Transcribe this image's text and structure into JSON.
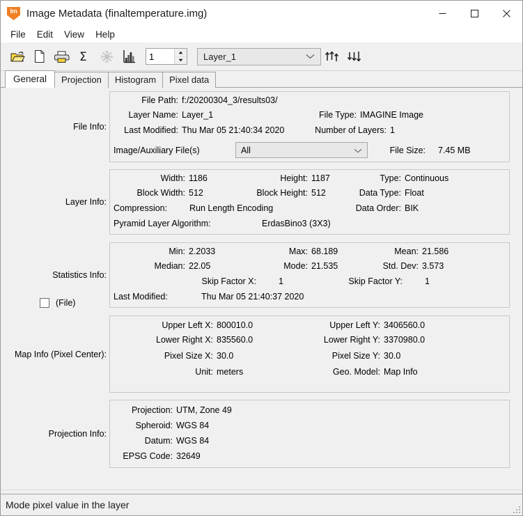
{
  "window": {
    "title": "Image Metadata (finaltemperature.img)",
    "app_icon_text": "Im",
    "minimize_label": "Minimize",
    "maximize_label": "Maximize",
    "close_label": "Close"
  },
  "menubar": {
    "items": [
      {
        "label": "File"
      },
      {
        "label": "Edit"
      },
      {
        "label": "View"
      },
      {
        "label": "Help"
      }
    ]
  },
  "toolbar": {
    "icons": [
      {
        "name": "open-folder-icon",
        "title": "Open"
      },
      {
        "name": "new-file-icon",
        "title": "New"
      },
      {
        "name": "print-icon",
        "title": "Print"
      },
      {
        "name": "sigma-statistics-icon",
        "title": "Statistics"
      },
      {
        "name": "snowflake-icon",
        "title": "Compute"
      },
      {
        "name": "histogram-chart-icon",
        "title": "Histogram"
      }
    ],
    "layer_number": "1",
    "layer_select_value": "Layer_1",
    "layer_select_options": [
      "Layer_1"
    ],
    "up-arrows-title": "Previous layer",
    "down-arrows-title": "Next layer"
  },
  "tabs": [
    {
      "label": "General",
      "active": true
    },
    {
      "label": "Projection",
      "active": false
    },
    {
      "label": "Histogram",
      "active": false
    },
    {
      "label": "Pixel data",
      "active": false
    }
  ],
  "sections": {
    "file_info": {
      "label": "File Info:",
      "file_path_label": "File Path:",
      "file_path_value": "f:/20200304_3/results03/",
      "layer_name_label": "Layer Name:",
      "layer_name_value": "Layer_1",
      "file_type_label": "File Type:",
      "file_type_value": "IMAGINE Image",
      "last_modified_label": "Last Modified:",
      "last_modified_value": "Thu Mar 05 21:40:34 2020",
      "number_of_layers_label": "Number of Layers:",
      "number_of_layers_value": "1",
      "aux_files_label": "Image/Auxiliary File(s)",
      "aux_files_value": "All",
      "aux_files_options": [
        "All"
      ],
      "file_size_label": "File Size:",
      "file_size_value": "7.45 MB"
    },
    "layer_info": {
      "label": "Layer Info:",
      "width_label": "Width:",
      "width_value": "1186",
      "height_label": "Height:",
      "height_value": "1187",
      "type_label": "Type:",
      "type_value": "Continuous",
      "block_width_label": "Block Width:",
      "block_width_value": "512",
      "block_height_label": "Block Height:",
      "block_height_value": "512",
      "data_type_label": "Data Type:",
      "data_type_value": "Float",
      "compression_label": "Compression:",
      "compression_value": "Run Length Encoding",
      "data_order_label": "Data Order:",
      "data_order_value": "BIK",
      "pyramid_label": "Pyramid Layer Algorithm:",
      "pyramid_value": "ErdasBino3 (3X3)"
    },
    "statistics_info": {
      "label": "Statistics Info:",
      "file_checkbox_label": "(File)",
      "file_checkbox_checked": false,
      "min_label": "Min:",
      "min_value": "2.2033",
      "max_label": "Max:",
      "max_value": "68.189",
      "mean_label": "Mean:",
      "mean_value": "21.586",
      "median_label": "Median:",
      "median_value": "22.05",
      "mode_label": "Mode:",
      "mode_value": "21.535",
      "stddev_label": "Std. Dev:",
      "stddev_value": "3.573",
      "skip_x_label": "Skip Factor X:",
      "skip_x_value": "1",
      "skip_y_label": "Skip Factor Y:",
      "skip_y_value": "1",
      "last_modified_label": "Last Modified:",
      "last_modified_value": "Thu Mar 05 21:40:37 2020"
    },
    "map_info": {
      "label": "Map Info (Pixel Center):",
      "upper_left_x_label": "Upper Left X:",
      "upper_left_x_value": "800010.0",
      "upper_left_y_label": "Upper Left Y:",
      "upper_left_y_value": "3406560.0",
      "lower_right_x_label": "Lower Right X:",
      "lower_right_x_value": "835560.0",
      "lower_right_y_label": "Lower Right Y:",
      "lower_right_y_value": "3370980.0",
      "pixel_size_x_label": "Pixel Size X:",
      "pixel_size_x_value": "30.0",
      "pixel_size_y_label": "Pixel Size Y:",
      "pixel_size_y_value": "30.0",
      "unit_label": "Unit:",
      "unit_value": "meters",
      "geo_model_label": "Geo. Model:",
      "geo_model_value": "Map Info"
    },
    "projection_info": {
      "label": "Projection Info:",
      "projection_label": "Projection:",
      "projection_value": "UTM, Zone 49",
      "spheroid_label": "Spheroid:",
      "spheroid_value": "WGS 84",
      "datum_label": "Datum:",
      "datum_value": "WGS 84",
      "epsg_label": "EPSG Code:",
      "epsg_value": "32649"
    }
  },
  "statusbar": {
    "text": "Mode pixel value in the layer"
  },
  "colors": {
    "accent": "#ef8024",
    "window_bg": "#f0f0f0",
    "border": "#c8c8c8"
  }
}
